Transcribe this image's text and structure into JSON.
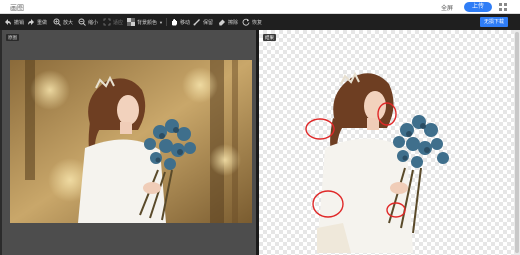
{
  "header": {
    "app_title": "画图",
    "fullscreen_label": "全屏",
    "upload_label": "上传",
    "grid_icon": "grid-icon"
  },
  "toolbar": {
    "items": [
      {
        "icon": "undo-icon",
        "label": "撤销"
      },
      {
        "icon": "redo-icon",
        "label": "重做"
      },
      {
        "icon": "zoom-in-icon",
        "label": "放大"
      },
      {
        "icon": "zoom-out-icon",
        "label": "缩小"
      },
      {
        "icon": "fit-icon",
        "label": "适应"
      },
      {
        "icon": "mosaic-icon",
        "label": "背景颜色"
      },
      {
        "icon": "hand-icon",
        "label": "移动"
      },
      {
        "icon": "brush-icon",
        "label": "保留"
      },
      {
        "icon": "eraser-icon",
        "label": "擦除"
      },
      {
        "icon": "restore-icon",
        "label": "恢复"
      }
    ],
    "download_label": "无损下载"
  },
  "left_pane": {
    "badge": "原图"
  },
  "right_pane": {
    "badge": "结果"
  },
  "colors": {
    "accent": "#2f7df6",
    "highlight_circle": "#e02828",
    "toolbar_bg": "#1f1f1f",
    "left_bg": "#4d4d4d"
  }
}
